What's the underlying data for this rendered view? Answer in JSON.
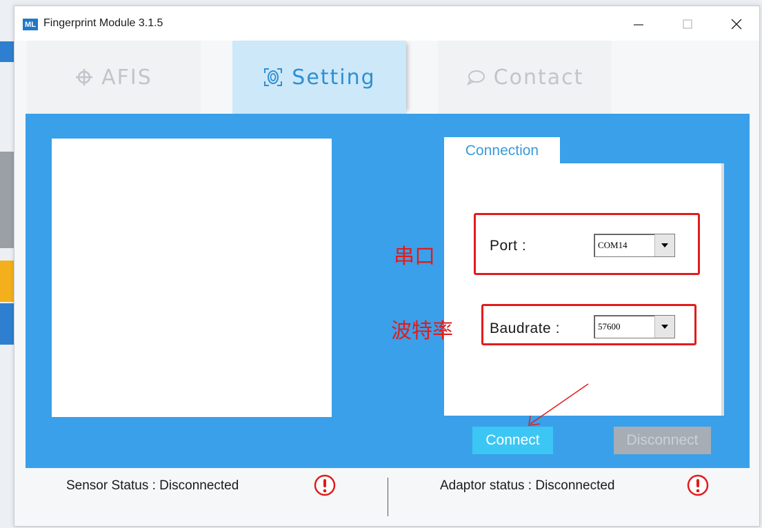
{
  "window": {
    "title": "Fingerprint Module 3.1.5",
    "logo_text": "ML"
  },
  "window_controls": {
    "minimize": "minimize-icon",
    "maximize": "maximize-icon",
    "close": "close-icon"
  },
  "tabs": [
    {
      "label": "AFIS",
      "icon": "crosshair-icon",
      "active": false
    },
    {
      "label": "Setting",
      "icon": "fingerprint-icon",
      "active": true
    },
    {
      "label": "Contact",
      "icon": "chat-bubble-icon",
      "active": false
    }
  ],
  "connection": {
    "tab_label": "Connection",
    "port_label": "Port :",
    "port_value": "COM14",
    "baudrate_label": "Baudrate :",
    "baudrate_value": "57600",
    "connect_label": "Connect",
    "disconnect_label": "Disconnect"
  },
  "annotations": {
    "port_note": "串口",
    "baudrate_note": "波特率"
  },
  "status": {
    "sensor": "Sensor Status : Disconnected",
    "adaptor": "Adaptor status : Disconnected"
  },
  "colors": {
    "panel_blue": "#3aa0ea",
    "active_tab": "#cde8f8",
    "connect_button": "#3cc6f4",
    "disconnect_button": "#a7adb5",
    "annotation_red": "#e21b1b",
    "status_icon": "#e21b1b"
  }
}
